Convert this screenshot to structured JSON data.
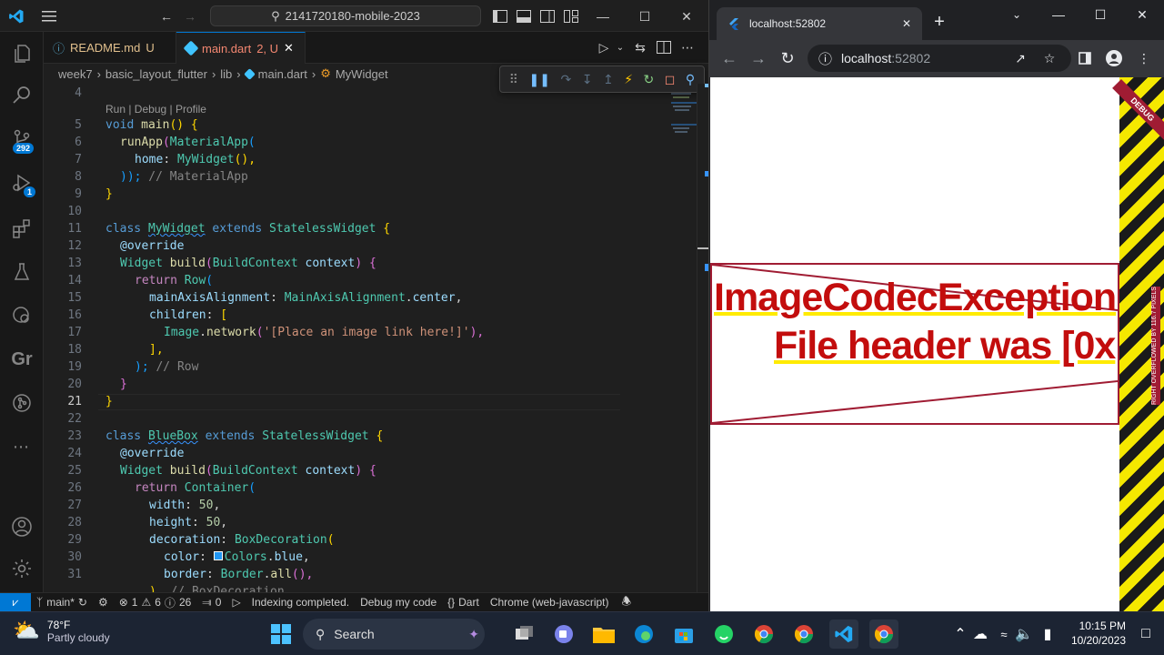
{
  "vscode": {
    "search_text": "2141720180-mobile-2023",
    "tabs": [
      {
        "name": "README.md",
        "flag": "U"
      },
      {
        "name": "main.dart",
        "flag": "2, U"
      }
    ],
    "breadcrumb": [
      "week7",
      "basic_layout_flutter",
      "lib",
      "main.dart",
      "MyWidget"
    ],
    "badges": {
      "source_control": "292",
      "run_debug": "1"
    },
    "codelens": "Run | Debug | Profile",
    "activity_gr": "Gr",
    "line_numbers": [
      "4",
      "5",
      "6",
      "7",
      "8",
      "9",
      "10",
      "11",
      "12",
      "13",
      "14",
      "15",
      "16",
      "17",
      "18",
      "19",
      "20",
      "21",
      "22",
      "23",
      "24",
      "25",
      "26",
      "27",
      "28",
      "29",
      "30",
      "31"
    ],
    "code": {
      "l5": [
        "void",
        " ",
        "main",
        "()",
        " {"
      ],
      "l6": [
        "runApp",
        "(",
        "MaterialApp",
        "("
      ],
      "l7": [
        "home",
        ": ",
        "MyWidget",
        "(),"
      ],
      "l8": [
        "));",
        " // MaterialApp"
      ],
      "l9": [
        "}"
      ],
      "l11": [
        "class",
        " ",
        "MyWidget",
        " ",
        "extends",
        " ",
        "StatelessWidget",
        " {"
      ],
      "l12": [
        "@override"
      ],
      "l13": [
        "Widget",
        " ",
        "build",
        "(",
        "BuildContext",
        " ",
        "context",
        ") {"
      ],
      "l14": [
        "return",
        " ",
        "Row",
        "("
      ],
      "l15": [
        "mainAxisAlignment",
        ": ",
        "MainAxisAlignment",
        ".",
        "center",
        ","
      ],
      "l16": [
        "children",
        ": ",
        "["
      ],
      "l17": [
        "Image",
        ".",
        "network",
        "(",
        "'[Place an image link here!]'",
        "),"
      ],
      "l18": [
        "],"
      ],
      "l19": [
        ");",
        " // Row"
      ],
      "l20": [
        "}"
      ],
      "l21": [
        "}"
      ],
      "l23": [
        "class",
        " ",
        "BlueBox",
        " ",
        "extends",
        " ",
        "StatelessWidget",
        " {"
      ],
      "l24": [
        "@override"
      ],
      "l25": [
        "Widget",
        " ",
        "build",
        "(",
        "BuildContext",
        " ",
        "context",
        ") {"
      ],
      "l26": [
        "return",
        " ",
        "Container",
        "("
      ],
      "l27": [
        "width",
        ": ",
        "50",
        ","
      ],
      "l28": [
        "height",
        ": ",
        "50",
        ","
      ],
      "l29": [
        "decoration",
        ": ",
        "BoxDecoration",
        "("
      ],
      "l30": [
        "color",
        ": ",
        "Colors",
        ".",
        "blue",
        ","
      ],
      "l31": [
        "border",
        ": ",
        "Border",
        ".",
        "all",
        "(),"
      ],
      "l32": [
        "),",
        " // BoxDecoration"
      ]
    },
    "status": {
      "branch": "main*",
      "errors": "1",
      "warnings": "6",
      "infos": "26",
      "ports": "0",
      "indexing": "Indexing completed.",
      "debug": "Debug my code",
      "language": "Dart",
      "device": "Chrome (web-javascript)"
    }
  },
  "chrome": {
    "tab_title": "localhost:52802",
    "address_host": "localhost",
    "address_port": ":52802",
    "page": {
      "error_line1": "ImageCodecException",
      "error_line2": "File header was [0x",
      "debug_banner": "DEBUG",
      "overflow_text": "RIGHT OVERFLOWED BY 116.7 PIXELS"
    }
  },
  "taskbar": {
    "temperature": "78°F",
    "weather": "Partly cloudy",
    "search_label": "Search",
    "time": "10:15 PM",
    "date": "10/20/2023"
  },
  "colors": {
    "vscode_accent": "#0078d4",
    "error_red": "#c30d0d",
    "overflow_yellow": "#f5e800"
  }
}
